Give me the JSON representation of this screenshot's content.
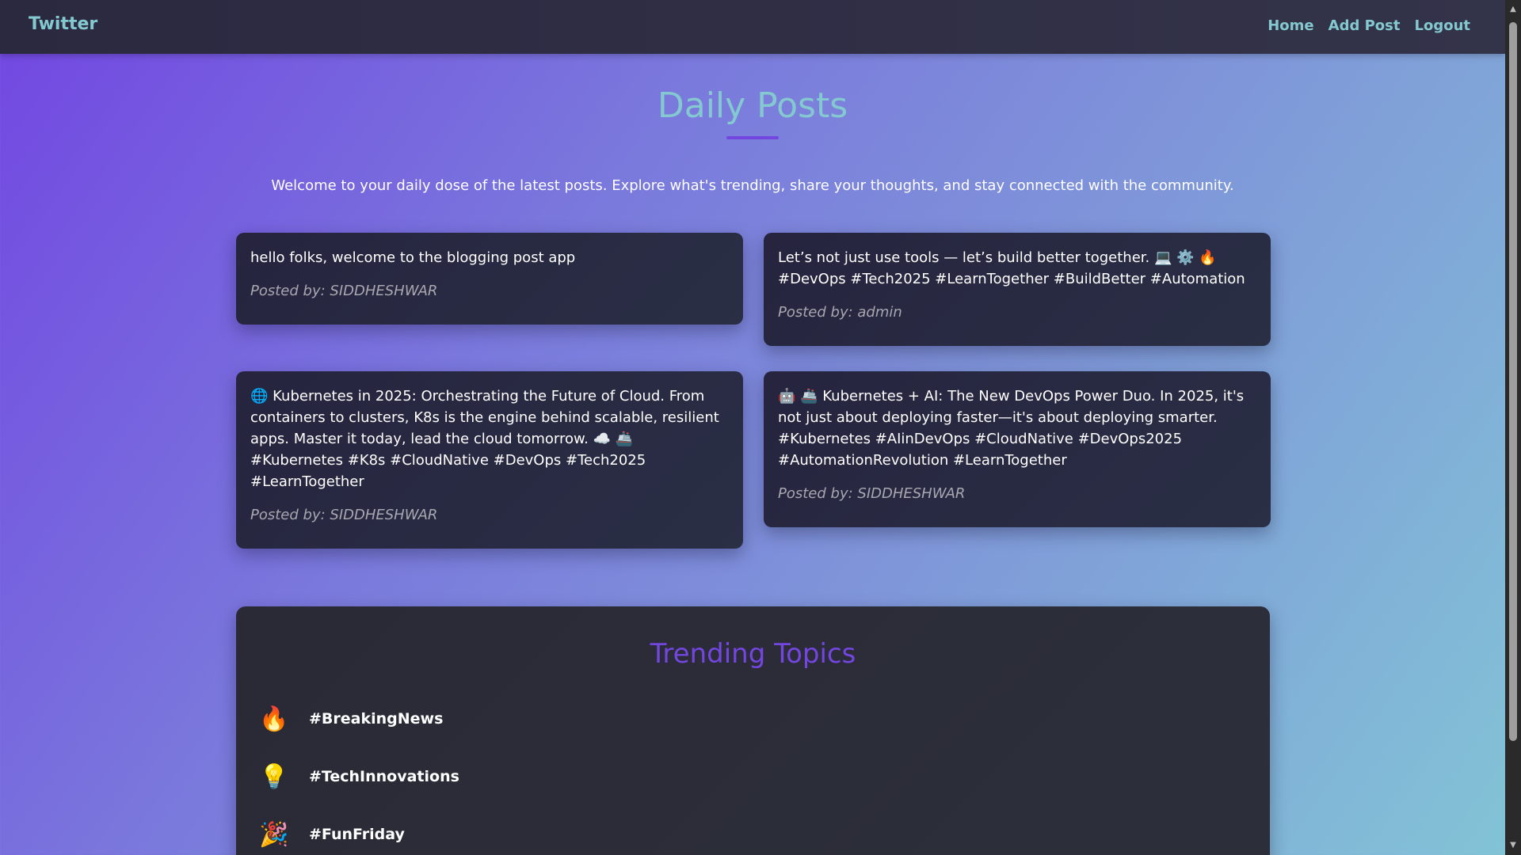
{
  "nav": {
    "brand": "Twitter",
    "links": [
      "Home",
      "Add Post",
      "Logout"
    ]
  },
  "page": {
    "title": "Daily Posts",
    "intro": "Welcome to your daily dose of the latest posts. Explore what's trending, share your thoughts, and stay connected with the community."
  },
  "posts": [
    {
      "text": "hello folks, welcome to the blogging post app",
      "author": "Posted by: SIDDHESHWAR"
    },
    {
      "text": "Let’s not just use tools — let’s build better together. 💻 ⚙️ 🔥 #DevOps #Tech2025 #LearnTogether #BuildBetter #Automation",
      "author": "Posted by: admin"
    },
    {
      "text": "🌐 Kubernetes in 2025: Orchestrating the Future of Cloud. From containers to clusters, K8s is the engine behind scalable, resilient apps. Master it today, lead the cloud tomorrow. ☁️ 🚢 #Kubernetes #K8s #CloudNative #DevOps #Tech2025 #LearnTogether",
      "author": "Posted by: SIDDHESHWAR"
    },
    {
      "text": "🤖 🚢 Kubernetes + AI: The New DevOps Power Duo. In 2025, it's not just about deploying faster—it's about deploying smarter. #Kubernetes #AIinDevOps #CloudNative #DevOps2025 #AutomationRevolution #LearnTogether",
      "author": "Posted by: SIDDHESHWAR"
    }
  ],
  "trending": {
    "title": "Trending Topics",
    "topics": [
      {
        "icon": "🔥",
        "label": "#BreakingNews"
      },
      {
        "icon": "💡",
        "label": "#TechInnovations"
      },
      {
        "icon": "🎉",
        "label": "#FunFriday"
      }
    ]
  },
  "colors": {
    "accent_teal": "#83c9cf",
    "accent_purple": "#7346e0",
    "card_bg": "#27263f"
  }
}
